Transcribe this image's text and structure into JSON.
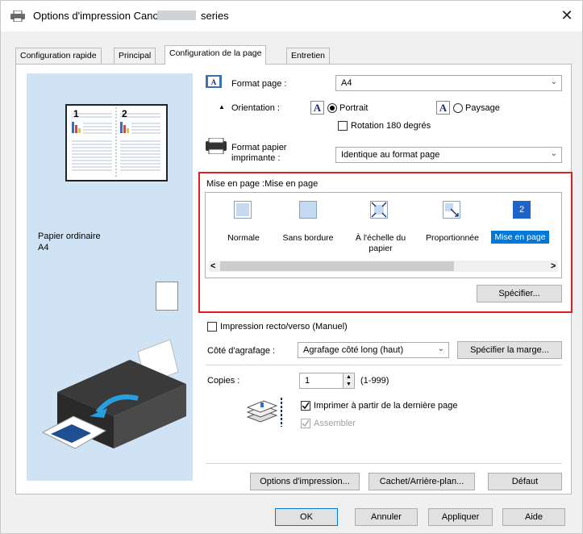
{
  "window": {
    "title_prefix": "Options d'impression Canon",
    "title_suffix": "series",
    "close_glyph": "✕"
  },
  "tabs": [
    {
      "label": "Configuration rapide"
    },
    {
      "label": "Principal"
    },
    {
      "label": "Configuration de la page",
      "active": true
    },
    {
      "label": "Entretien"
    }
  ],
  "preview": {
    "media_type": "Papier ordinaire",
    "paper_size": "A4",
    "thumb_page_numbers": [
      "1",
      "2"
    ]
  },
  "page_setup": {
    "format_page_label": "Format page :",
    "format_page_value": "A4",
    "orientation_label": "Orientation :",
    "orientation_icon_glyph": "A",
    "portrait_label": "Portrait",
    "paysage_label": "Paysage",
    "orientation_selected": "Portrait",
    "rotation_label": "Rotation 180 degrés",
    "rotation_checked": false,
    "printer_paper_label_1": "Format papier",
    "printer_paper_label_2": "imprimante :",
    "printer_paper_value": "Identique au format page"
  },
  "layout": {
    "group_label": "Mise en page :Mise en page",
    "options": [
      {
        "label": "Normale",
        "icon": "normal-layout-icon"
      },
      {
        "label": "Sans bordure",
        "icon": "borderless-layout-icon"
      },
      {
        "label": "À l'échelle du papier",
        "label_line1": "À l'échelle du",
        "label_line2": "papier",
        "icon": "fit-to-page-icon"
      },
      {
        "label": "Proportionnée",
        "icon": "scaled-layout-icon"
      },
      {
        "label": "Mise en page",
        "icon": "page-layout-icon",
        "icon_glyph": "2",
        "selected": true
      }
    ],
    "scroll_left": "<",
    "scroll_right": ">",
    "specify_button": "Spécifier..."
  },
  "duplex": {
    "label": "Impression recto/verso (Manuel)",
    "checked": false
  },
  "stapling": {
    "label": "Côté d'agrafage :",
    "value": "Agrafage côté long (haut)",
    "margin_button": "Spécifier la marge..."
  },
  "copies": {
    "label": "Copies :",
    "value": "1",
    "range": "(1-999)",
    "reverse_label": "Imprimer à partir de la dernière page",
    "reverse_checked": true,
    "collate_label": "Assembler",
    "collate_checked": true,
    "collate_disabled": true
  },
  "bottom_buttons": {
    "print_options": "Options d'impression...",
    "stamp_background": "Cachet/Arrière-plan...",
    "defaults": "Défaut"
  },
  "dialog_buttons": {
    "ok": "OK",
    "cancel": "Annuler",
    "apply": "Appliquer",
    "help": "Aide"
  },
  "colors": {
    "selection_blue": "#0078d7",
    "highlight_red": "#e02020",
    "preview_bg": "#cfe3f5"
  }
}
